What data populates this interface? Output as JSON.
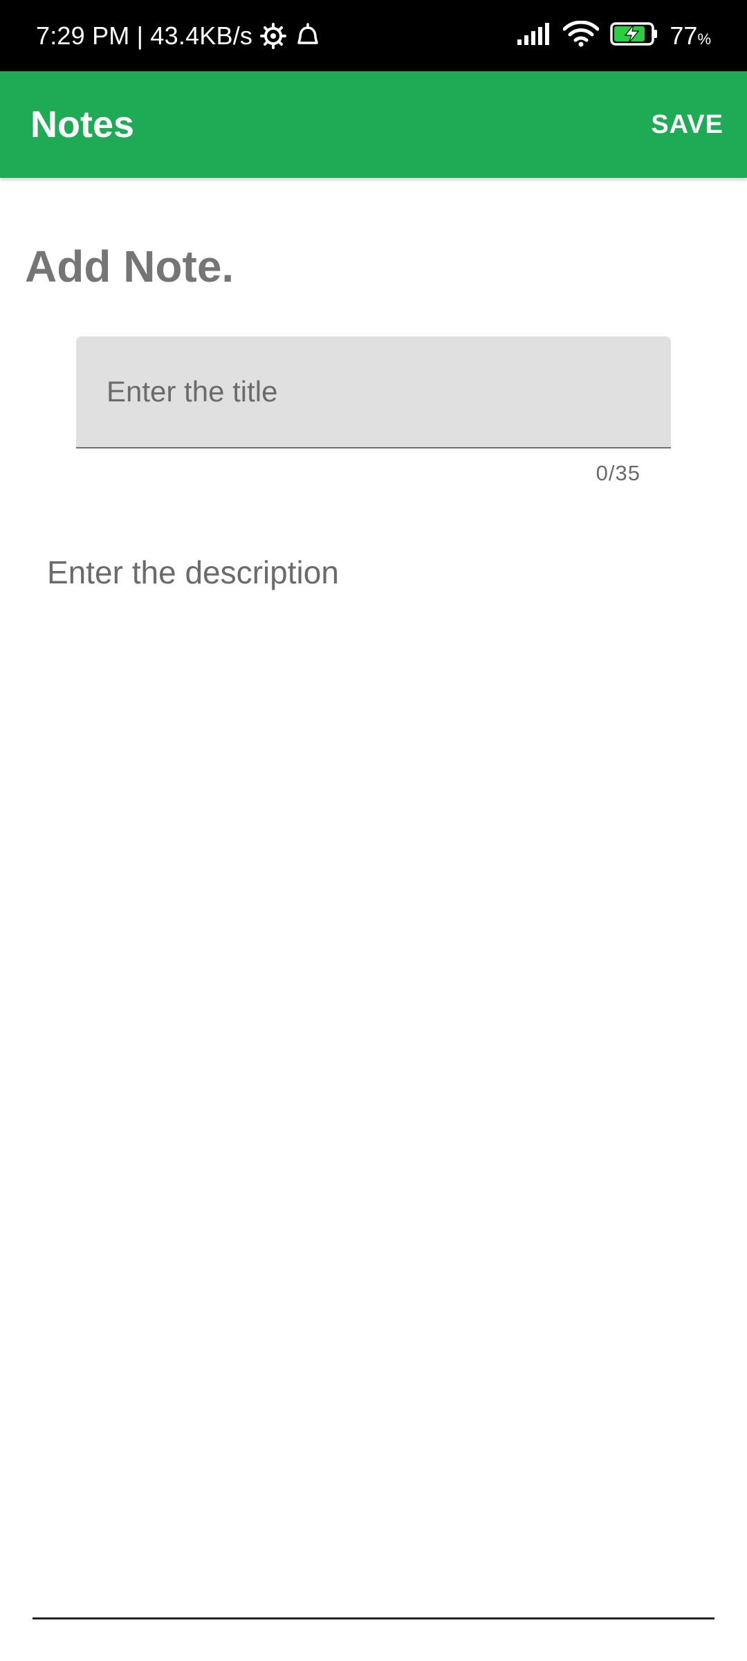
{
  "status_bar": {
    "time_speed": "7:29 PM | 43.4KB/s",
    "battery_percent": "77",
    "battery_unit": "%",
    "icons": [
      "settings-icon",
      "alarm-icon",
      "signal-icon",
      "wifi-icon",
      "battery-charging-icon"
    ]
  },
  "app_bar": {
    "title": "Notes",
    "save_label": "SAVE"
  },
  "form": {
    "heading": "Add Note.",
    "title_placeholder": "Enter the title",
    "title_value": "",
    "counter": "0/35",
    "description_placeholder": "Enter the description",
    "description_value": ""
  },
  "colors": {
    "app_bar": "#1faa55",
    "status_bar": "#000000",
    "field_bg": "#e0e0e0",
    "heading_text": "#757575"
  }
}
